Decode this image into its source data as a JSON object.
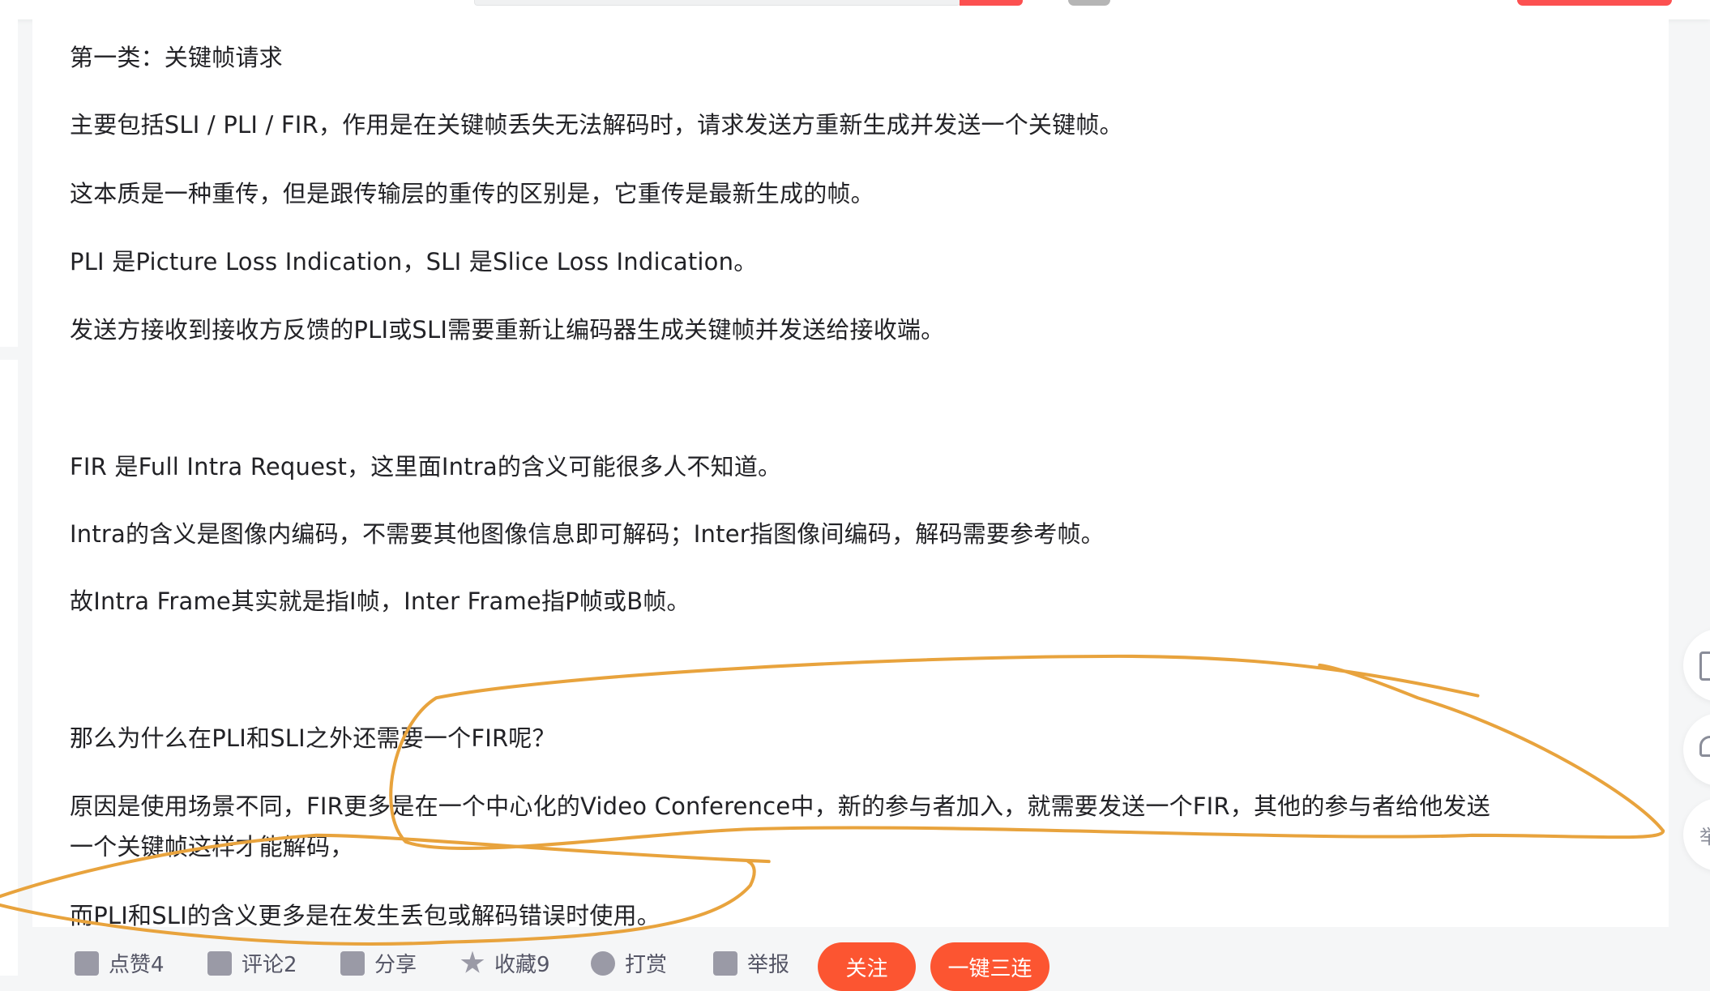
{
  "article": {
    "lines": [
      "第一类：关键帧请求",
      "主要包括SLI / PLI / FIR，作用是在关键帧丢失无法解码时，请求发送方重新生成并发送一个关键帧。",
      "这本质是一种重传，但是跟传输层的重传的区别是，它重传是最新生成的帧。",
      "PLI 是Picture Loss Indication，SLI 是Slice Loss Indication。",
      "发送方接收到接收方反馈的PLI或SLI需要重新让编码器生成关键帧并发送给接收端。",
      "FIR 是Full Intra Request，这里面Intra的含义可能很多人不知道。",
      "Intra的含义是图像内编码，不需要其他图像信息即可解码；Inter指图像间编码，解码需要参考帧。",
      "故Intra Frame其实就是指I帧，Inter Frame指P帧或B帧。",
      "那么为什么在PLI和SLI之外还需要一个FIR呢？",
      "原因是使用场景不同，FIR更多是在一个中心化的Video Conference中，新的参与者加入，就需要发送一个FIR，其他的参与者给他发送",
      "一个关键帧这样才能解码，",
      "而PLI和SLI的含义更多是在发生丢包或解码错误时使用。"
    ]
  },
  "toolbar": {
    "like": "点赞4",
    "comment": "评论2",
    "share": "分享",
    "favorite": "收藏9",
    "reward": "打赏",
    "report": "举报",
    "follow": "关注",
    "triple": "一键三连"
  },
  "side": {
    "report": "举"
  },
  "colors": {
    "accent": "#fc5531",
    "annotation": "#e8a33d"
  }
}
